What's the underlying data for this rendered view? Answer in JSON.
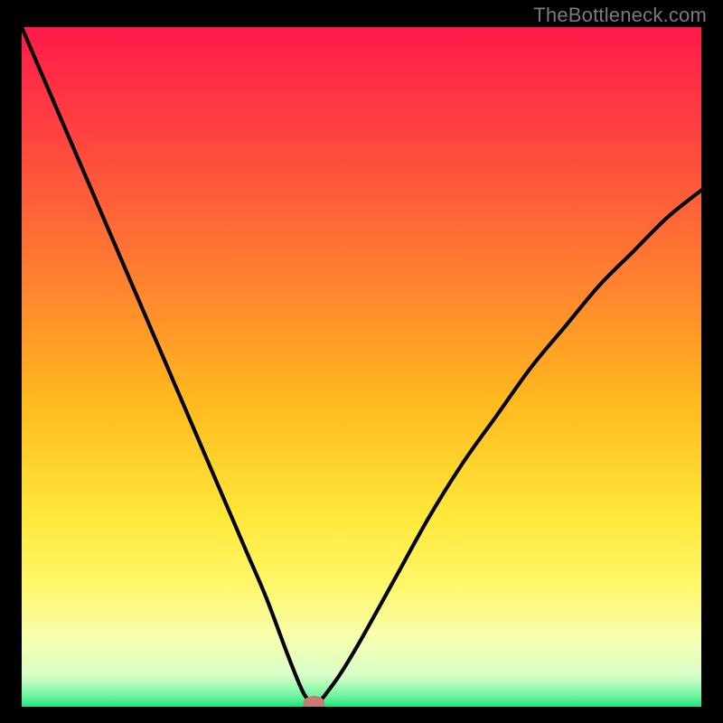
{
  "watermark": "TheBottleneck.com",
  "colors": {
    "frame": "#000000",
    "curve": "#000000",
    "marker_fill": "#c77b74",
    "gradient_stops": [
      {
        "offset": 0.0,
        "color": "#ff1a4b"
      },
      {
        "offset": 0.15,
        "color": "#ff4140"
      },
      {
        "offset": 0.35,
        "color": "#ff7a32"
      },
      {
        "offset": 0.55,
        "color": "#ffb91e"
      },
      {
        "offset": 0.72,
        "color": "#ffe83a"
      },
      {
        "offset": 0.82,
        "color": "#fff76a"
      },
      {
        "offset": 0.9,
        "color": "#f7ffb0"
      },
      {
        "offset": 0.955,
        "color": "#d8ffc8"
      },
      {
        "offset": 0.985,
        "color": "#6cf3a0"
      },
      {
        "offset": 1.0,
        "color": "#17e67e"
      }
    ]
  },
  "chart_data": {
    "type": "line",
    "title": "",
    "xlabel": "",
    "ylabel": "",
    "xlim": [
      0,
      100
    ],
    "ylim": [
      0,
      100
    ],
    "optimum_x": 43,
    "series": [
      {
        "name": "bottleneck-curve",
        "x": [
          0,
          3,
          6,
          9,
          12,
          15,
          18,
          21,
          24,
          27,
          30,
          33,
          36,
          39,
          41,
          42,
          43,
          44,
          45,
          47,
          50,
          55,
          60,
          65,
          70,
          75,
          80,
          85,
          90,
          95,
          100
        ],
        "y": [
          100,
          93,
          86,
          79,
          72,
          65,
          58,
          51,
          44,
          37,
          30,
          23,
          16,
          8,
          3,
          1.2,
          0.5,
          1.0,
          2.2,
          5,
          10,
          19,
          28,
          36,
          43,
          50,
          56,
          62,
          67,
          72,
          76
        ]
      }
    ],
    "marker": {
      "x": 43,
      "y": 0.5,
      "rx": 1.6,
      "ry": 1.1
    }
  }
}
